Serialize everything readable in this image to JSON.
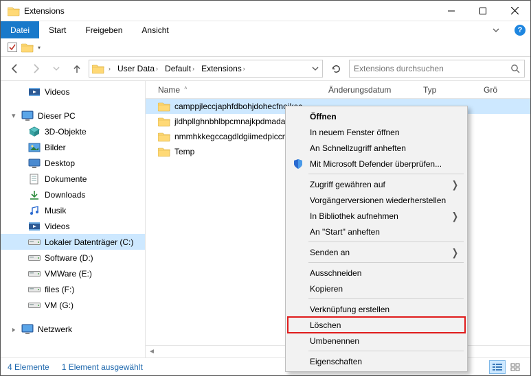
{
  "window": {
    "title": "Extensions"
  },
  "ribbon": {
    "tabs": [
      "Datei",
      "Start",
      "Freigeben",
      "Ansicht"
    ],
    "active_index": 0
  },
  "address": {
    "crumbs": [
      "User Data",
      "Default",
      "Extensions"
    ]
  },
  "search": {
    "placeholder": "Extensions durchsuchen"
  },
  "columns": {
    "name": "Name",
    "modified": "Änderungsdatum",
    "type": "Typ",
    "size": "Grö"
  },
  "rows": [
    {
      "name": "camppjleccjaphfdbohjdohecfnoikec",
      "selected": true
    },
    {
      "name": "jldhpllghnbhlbpcmnajkpdmadaolakh",
      "selected": false
    },
    {
      "name": "nmmhkkegccagdldgiimedpiccmgmieda",
      "selected": false
    },
    {
      "name": "Temp",
      "selected": false
    }
  ],
  "sidebar": {
    "top": {
      "label": "Videos",
      "icon": "videos"
    },
    "pc_label": "Dieser PC",
    "items": [
      {
        "label": "3D-Objekte",
        "icon": "cube"
      },
      {
        "label": "Bilder",
        "icon": "pictures"
      },
      {
        "label": "Desktop",
        "icon": "desktop"
      },
      {
        "label": "Dokumente",
        "icon": "documents"
      },
      {
        "label": "Downloads",
        "icon": "downloads"
      },
      {
        "label": "Musik",
        "icon": "music"
      },
      {
        "label": "Videos",
        "icon": "videos"
      },
      {
        "label": "Lokaler Datenträger (C:)",
        "icon": "drive",
        "selected": true
      },
      {
        "label": "Software (D:)",
        "icon": "drive"
      },
      {
        "label": "VMWare (E:)",
        "icon": "drive"
      },
      {
        "label": "files (F:)",
        "icon": "drive"
      },
      {
        "label": "VM (G:)",
        "icon": "drive"
      }
    ],
    "network_label": "Netzwerk"
  },
  "status": {
    "count": "4 Elemente",
    "selected": "1 Element ausgewählt"
  },
  "context_menu": {
    "items": [
      {
        "label": "Öffnen",
        "bold": true
      },
      {
        "label": "In neuem Fenster öffnen"
      },
      {
        "label": "An Schnellzugriff anheften"
      },
      {
        "label": "Mit Microsoft Defender überprüfen...",
        "icon": "shield"
      },
      {
        "sep": true
      },
      {
        "label": "Zugriff gewähren auf",
        "submenu": true
      },
      {
        "label": "Vorgängerversionen wiederherstellen"
      },
      {
        "label": "In Bibliothek aufnehmen",
        "submenu": true
      },
      {
        "label": "An \"Start\" anheften"
      },
      {
        "sep": true
      },
      {
        "label": "Senden an",
        "submenu": true
      },
      {
        "sep": true
      },
      {
        "label": "Ausschneiden"
      },
      {
        "label": "Kopieren"
      },
      {
        "sep": true
      },
      {
        "label": "Verknüpfung erstellen"
      },
      {
        "label": "Löschen",
        "highlight": true
      },
      {
        "label": "Umbenennen"
      },
      {
        "sep": true
      },
      {
        "label": "Eigenschaften"
      }
    ]
  }
}
